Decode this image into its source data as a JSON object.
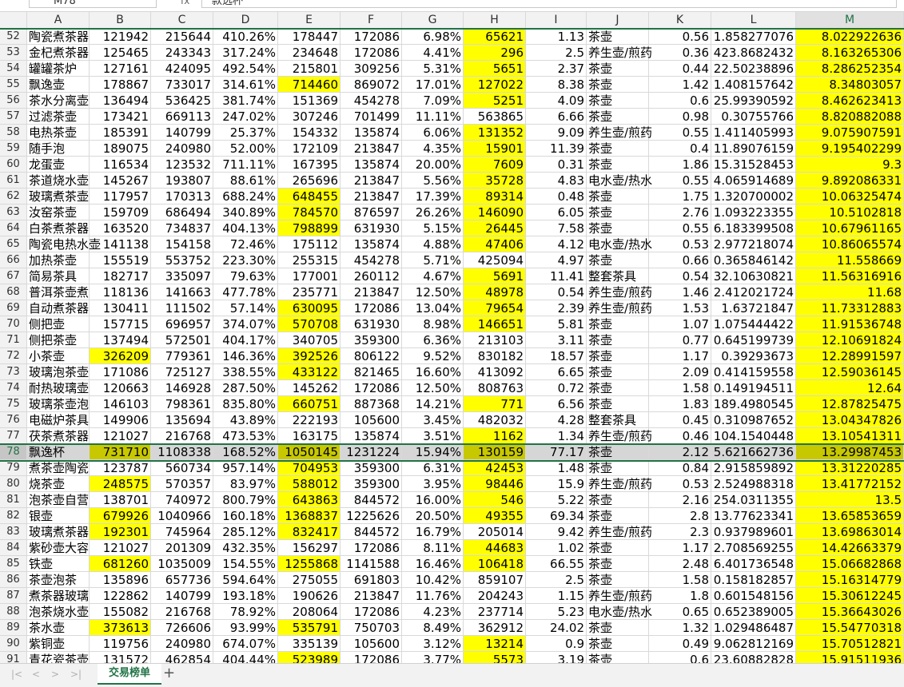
{
  "formula_bar": {
    "name_box": "M78",
    "fx": "fx",
    "formula": "款选杯"
  },
  "columns": [
    "A",
    "B",
    "C",
    "D",
    "E",
    "F",
    "G",
    "H",
    "I",
    "J",
    "K",
    "L",
    "M"
  ],
  "active_column": "M",
  "active_row": 78,
  "sheet": {
    "active_tab": "交易榜单",
    "add_label": "+"
  },
  "rows": [
    {
      "n": 52,
      "c": [
        "陶瓷煮茶器",
        "121942",
        "215644",
        "410.26%",
        "178447",
        "172086",
        "6.98%",
        "65621",
        "1.13",
        "茶壶",
        "0.56",
        "1.858277076",
        "8.022922636"
      ],
      "hl": [
        7,
        12
      ]
    },
    {
      "n": 53,
      "c": [
        "金杞煮茶器",
        "125465",
        "243343",
        "317.24%",
        "234648",
        "172086",
        "4.41%",
        "296",
        "2.5",
        "养生壶/煎药",
        "0.36",
        "423.8682432",
        "8.163265306"
      ],
      "hl": [
        7,
        12
      ]
    },
    {
      "n": 54,
      "c": [
        "罐罐茶炉",
        "127161",
        "424095",
        "492.54%",
        "215801",
        "309256",
        "5.31%",
        "5651",
        "2.37",
        "茶壶",
        "0.44",
        "22.50238896",
        "8.286252354"
      ],
      "hl": [
        7,
        12
      ]
    },
    {
      "n": 55,
      "c": [
        "飘逸壶",
        "178867",
        "733017",
        "314.61%",
        "714460",
        "869072",
        "17.01%",
        "127022",
        "8.38",
        "茶壶",
        "1.42",
        "1.408157642",
        "8.34803057"
      ],
      "hl": [
        4,
        7,
        12
      ]
    },
    {
      "n": 56,
      "c": [
        "茶水分离壶",
        "136494",
        "536425",
        "381.74%",
        "151369",
        "454278",
        "7.09%",
        "5251",
        "4.09",
        "茶壶",
        "0.6",
        "25.99390592",
        "8.462623413"
      ],
      "hl": [
        7,
        12
      ]
    },
    {
      "n": 57,
      "c": [
        "过滤茶壶",
        "173421",
        "669113",
        "247.02%",
        "307246",
        "701499",
        "11.11%",
        "563865",
        "6.66",
        "茶壶",
        "0.98",
        "0.30755766",
        "8.820882088"
      ],
      "hl": [
        12
      ]
    },
    {
      "n": 58,
      "c": [
        "电热茶壶",
        "185391",
        "140799",
        "25.37%",
        "154332",
        "135874",
        "6.06%",
        "131352",
        "9.09",
        "养生壶/煎药",
        "0.55",
        "1.411405993",
        "9.075907591"
      ],
      "hl": [
        7,
        12
      ]
    },
    {
      "n": 59,
      "c": [
        "随手泡",
        "189075",
        "240980",
        "52.00%",
        "172109",
        "213847",
        "4.35%",
        "15901",
        "11.39",
        "茶壶",
        "0.4",
        "11.89076159",
        "9.195402299"
      ],
      "hl": [
        7,
        12
      ]
    },
    {
      "n": 60,
      "c": [
        "龙蛋壶",
        "116534",
        "123532",
        "711.11%",
        "167395",
        "135874",
        "20.00%",
        "7609",
        "0.31",
        "茶壶",
        "1.86",
        "15.31528453",
        "9.3"
      ],
      "hl": [
        7,
        12
      ]
    },
    {
      "n": 61,
      "c": [
        "茶道烧水壶",
        "145267",
        "193807",
        "88.61%",
        "265696",
        "213847",
        "5.56%",
        "35728",
        "4.83",
        "电水壶/热水",
        "0.55",
        "4.065914689",
        "9.892086331"
      ],
      "hl": [
        7,
        12
      ]
    },
    {
      "n": 62,
      "c": [
        "玻璃煮茶壶",
        "117957",
        "170313",
        "688.24%",
        "648455",
        "213847",
        "17.39%",
        "89314",
        "0.48",
        "茶壶",
        "1.75",
        "1.320700002",
        "10.06325474"
      ],
      "hl": [
        4,
        7,
        12
      ]
    },
    {
      "n": 63,
      "c": [
        "汝窑茶壶",
        "159709",
        "686494",
        "340.89%",
        "784570",
        "876597",
        "26.26%",
        "146090",
        "6.05",
        "茶壶",
        "2.76",
        "1.093223355",
        "10.5102818"
      ],
      "hl": [
        4,
        7,
        12
      ]
    },
    {
      "n": 64,
      "c": [
        "白茶煮茶器",
        "163520",
        "734837",
        "404.13%",
        "798899",
        "631930",
        "5.15%",
        "26445",
        "7.58",
        "茶壶",
        "0.55",
        "6.183399508",
        "10.67961165"
      ],
      "hl": [
        4,
        7,
        12
      ]
    },
    {
      "n": 65,
      "c": [
        "陶瓷电热水壶",
        "141138",
        "154158",
        "72.46%",
        "175112",
        "135874",
        "4.88%",
        "47406",
        "4.12",
        "电水壶/热水",
        "0.53",
        "2.977218074",
        "10.86065574"
      ],
      "hl": [
        7,
        12
      ]
    },
    {
      "n": 66,
      "c": [
        "加热茶壶",
        "155519",
        "553752",
        "223.30%",
        "255315",
        "454278",
        "5.71%",
        "425094",
        "4.97",
        "茶壶",
        "0.66",
        "0.365846142",
        "11.558669"
      ],
      "hl": [
        12
      ]
    },
    {
      "n": 67,
      "c": [
        "简易茶具",
        "182717",
        "335097",
        "79.63%",
        "177001",
        "260112",
        "4.67%",
        "5691",
        "11.41",
        "整套茶具",
        "0.54",
        "32.10630821",
        "11.56316916"
      ],
      "hl": [
        7,
        12
      ]
    },
    {
      "n": 68,
      "c": [
        "普洱茶壶煮",
        "118136",
        "141663",
        "477.78%",
        "235771",
        "213847",
        "12.50%",
        "48978",
        "0.54",
        "养生壶/煎药",
        "1.46",
        "2.412021724",
        "11.68"
      ],
      "hl": [
        7,
        12
      ]
    },
    {
      "n": 69,
      "c": [
        "自动煮茶器",
        "130411",
        "111502",
        "57.14%",
        "630095",
        "172086",
        "13.04%",
        "79654",
        "2.39",
        "养生壶/煎药",
        "1.53",
        "1.63721847",
        "11.73312883"
      ],
      "hl": [
        4,
        7,
        12
      ]
    },
    {
      "n": 70,
      "c": [
        "侧把壶",
        "157715",
        "696957",
        "374.07%",
        "570708",
        "631930",
        "8.98%",
        "146651",
        "5.81",
        "茶壶",
        "1.07",
        "1.075444422",
        "11.91536748"
      ],
      "hl": [
        4,
        7,
        12
      ]
    },
    {
      "n": 71,
      "c": [
        "侧把茶壶",
        "137494",
        "572501",
        "404.17%",
        "340705",
        "359300",
        "6.36%",
        "213103",
        "3.11",
        "茶壶",
        "0.77",
        "0.645199739",
        "12.10691824"
      ],
      "hl": [
        12
      ]
    },
    {
      "n": 72,
      "c": [
        "小茶壶",
        "326209",
        "779361",
        "146.36%",
        "392526",
        "806122",
        "9.52%",
        "830182",
        "18.57",
        "茶壶",
        "1.17",
        "0.39293673",
        "12.28991597"
      ],
      "hl": [
        1,
        4,
        12
      ]
    },
    {
      "n": 73,
      "c": [
        "玻璃泡茶壶",
        "171086",
        "725127",
        "338.55%",
        "433122",
        "821465",
        "16.60%",
        "413092",
        "6.65",
        "茶壶",
        "2.09",
        "0.414159558",
        "12.59036145"
      ],
      "hl": [
        4,
        12
      ]
    },
    {
      "n": 74,
      "c": [
        "耐热玻璃壶",
        "120663",
        "146928",
        "287.50%",
        "145262",
        "172086",
        "12.50%",
        "808763",
        "0.72",
        "茶壶",
        "1.58",
        "0.149194511",
        "12.64"
      ],
      "hl": [
        12
      ]
    },
    {
      "n": 75,
      "c": [
        "玻璃茶壶泡",
        "146103",
        "798361",
        "835.80%",
        "660751",
        "887368",
        "14.21%",
        "771",
        "6.56",
        "茶壶",
        "1.83",
        "189.4980545",
        "12.87825475"
      ],
      "hl": [
        4,
        7,
        12
      ]
    },
    {
      "n": 76,
      "c": [
        "电磁炉茶具",
        "149906",
        "135694",
        "43.89%",
        "222193",
        "105600",
        "3.45%",
        "482032",
        "4.28",
        "整套茶具",
        "0.45",
        "0.310987652",
        "13.04347826"
      ],
      "hl": [
        12
      ]
    },
    {
      "n": 77,
      "c": [
        "茯茶煮茶器",
        "121027",
        "216768",
        "473.53%",
        "163175",
        "135874",
        "3.51%",
        "1162",
        "1.34",
        "养生壶/煎药",
        "0.46",
        "104.1540448",
        "13.10541311"
      ],
      "hl": [
        7,
        12
      ]
    },
    {
      "n": 78,
      "c": [
        "飘逸杯",
        "731710",
        "1108338",
        "168.52%",
        "1050145",
        "1231224",
        "15.94%",
        "130159",
        "77.17",
        "茶壶",
        "2.12",
        "5.621662736",
        "13.29987453"
      ],
      "hl": [
        1,
        4,
        7,
        12
      ]
    },
    {
      "n": 79,
      "c": [
        "煮茶壶陶瓷",
        "123787",
        "560734",
        "957.14%",
        "704953",
        "359300",
        "6.31%",
        "42453",
        "1.48",
        "茶壶",
        "0.84",
        "2.915859892",
        "13.31220285"
      ],
      "hl": [
        4,
        7,
        12
      ]
    },
    {
      "n": 80,
      "c": [
        "烧茶壶",
        "248575",
        "570357",
        "83.97%",
        "588012",
        "359300",
        "3.95%",
        "98446",
        "15.9",
        "养生壶/煎药",
        "0.53",
        "2.524988318",
        "13.41772152"
      ],
      "hl": [
        1,
        4,
        7,
        12
      ]
    },
    {
      "n": 81,
      "c": [
        "泡茶壶自营",
        "138701",
        "740972",
        "800.79%",
        "643863",
        "844572",
        "16.00%",
        "546",
        "5.22",
        "茶壶",
        "2.16",
        "254.0311355",
        "13.5"
      ],
      "hl": [
        4,
        7,
        12
      ]
    },
    {
      "n": 82,
      "c": [
        "银壶",
        "679926",
        "1040966",
        "160.18%",
        "1368837",
        "1225626",
        "20.50%",
        "49355",
        "69.34",
        "茶壶",
        "2.8",
        "13.77623341",
        "13.65853659"
      ],
      "hl": [
        1,
        4,
        7,
        12
      ]
    },
    {
      "n": 83,
      "c": [
        "玻璃煮茶器",
        "192301",
        "745964",
        "285.12%",
        "832417",
        "844572",
        "16.79%",
        "205014",
        "9.42",
        "养生壶/煎药",
        "2.3",
        "0.937989601",
        "13.69863014"
      ],
      "hl": [
        1,
        4,
        12
      ]
    },
    {
      "n": 84,
      "c": [
        "紫砂壶大容",
        "121027",
        "201309",
        "432.35%",
        "156297",
        "172086",
        "8.11%",
        "44683",
        "1.02",
        "茶壶",
        "1.17",
        "2.708569255",
        "14.42663379"
      ],
      "hl": [
        7,
        12
      ]
    },
    {
      "n": 85,
      "c": [
        "铁壶",
        "681260",
        "1035009",
        "154.55%",
        "1255868",
        "1141588",
        "16.46%",
        "106418",
        "66.55",
        "茶壶",
        "2.48",
        "6.401736548",
        "15.06682868"
      ],
      "hl": [
        1,
        4,
        7,
        12
      ]
    },
    {
      "n": 86,
      "c": [
        "茶壶泡茶",
        "135896",
        "657736",
        "594.64%",
        "275055",
        "691803",
        "10.42%",
        "859107",
        "2.5",
        "茶壶",
        "1.58",
        "0.158182857",
        "15.16314779"
      ],
      "hl": [
        12
      ]
    },
    {
      "n": 87,
      "c": [
        "煮茶器玻璃",
        "122862",
        "140799",
        "193.18%",
        "190626",
        "213847",
        "11.76%",
        "204243",
        "1.15",
        "养生壶/煎药",
        "1.8",
        "0.601548156",
        "15.30612245"
      ],
      "hl": [
        12
      ]
    },
    {
      "n": 88,
      "c": [
        "泡茶烧水壶",
        "155082",
        "216768",
        "78.92%",
        "208064",
        "172086",
        "4.23%",
        "237714",
        "5.23",
        "电水壶/热水",
        "0.65",
        "0.652389005",
        "15.36643026"
      ],
      "hl": [
        12
      ]
    },
    {
      "n": 89,
      "c": [
        "茶水壶",
        "373613",
        "726606",
        "93.99%",
        "535791",
        "750703",
        "8.49%",
        "362912",
        "24.02",
        "茶壶",
        "1.32",
        "1.029486487",
        "15.54770318"
      ],
      "hl": [
        1,
        4,
        12
      ]
    },
    {
      "n": 90,
      "c": [
        "紫铜壶",
        "119756",
        "240980",
        "674.07%",
        "335139",
        "105600",
        "3.12%",
        "13214",
        "0.9",
        "茶壶",
        "0.49",
        "9.062812169",
        "15.70512821"
      ],
      "hl": [
        7,
        12
      ]
    },
    {
      "n": 91,
      "c": [
        "青花瓷茶壶",
        "131572",
        "462854",
        "404.44%",
        "523989",
        "172086",
        "3.77%",
        "5573",
        "3.19",
        "茶壶",
        "0.6",
        "23.60882828",
        "15.91511936"
      ],
      "hl": [
        4,
        7,
        12
      ]
    }
  ]
}
